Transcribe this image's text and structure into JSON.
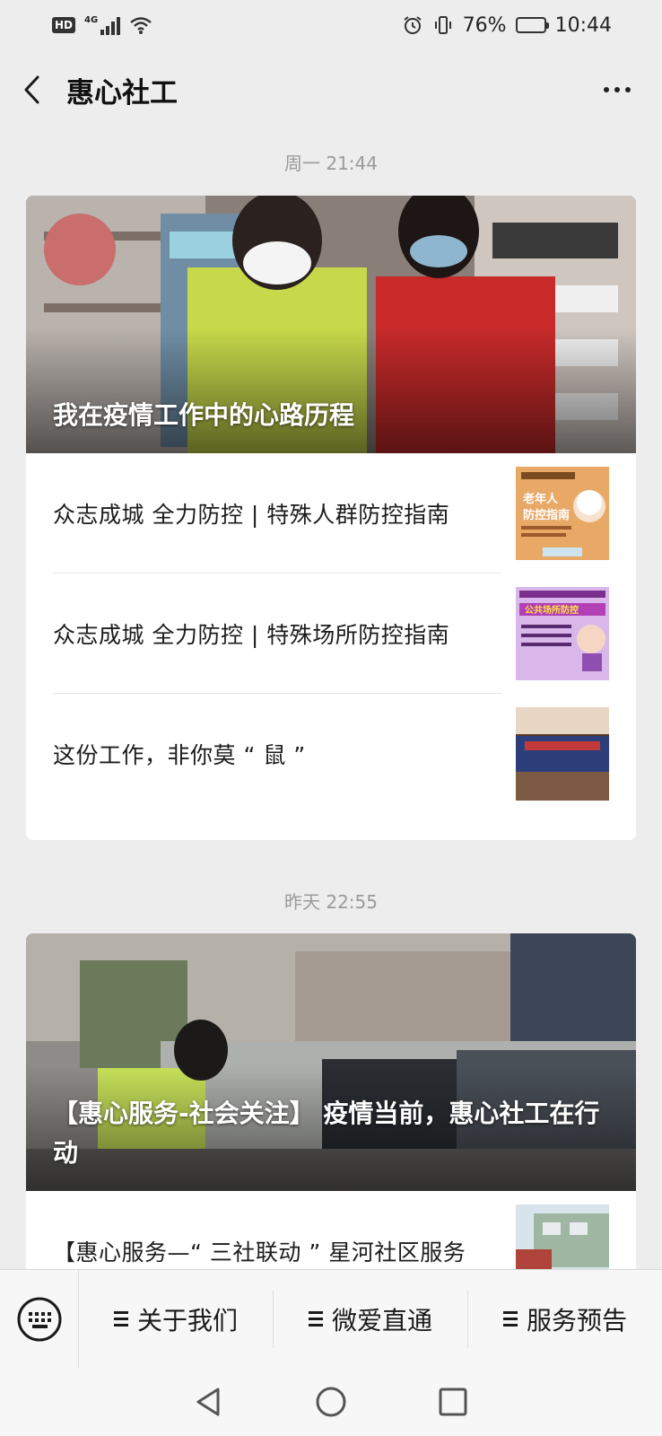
{
  "status_bar": {
    "hd": "HD",
    "network": "4G",
    "battery_percent_text": "76%",
    "battery_level": 0.76,
    "time": "10:44"
  },
  "nav": {
    "title": "惠心社工"
  },
  "groups": [
    {
      "timestamp": "周一 21:44",
      "cover_title": "我在疫情工作中的心路历程",
      "articles": [
        {
          "title": "众志成城  全力防控  | 特殊人群防控指南",
          "thumb_icon": "elderly-guide-thumbnail"
        },
        {
          "title": "众志成城  全力防控  | 特殊场所防控指南",
          "thumb_icon": "public-place-guide-thumbnail"
        },
        {
          "title": "这份工作，非你莫 “ 鼠 ”",
          "thumb_icon": "group-photo-thumbnail"
        }
      ]
    },
    {
      "timestamp": "昨天 22:55",
      "cover_title": "【惠心服务-社会关注】 疫情当前，惠心社工在行动",
      "articles": [
        {
          "title": "【惠心服务—“ 三社联动 ” 星河社区服务",
          "thumb_icon": "community-photo-thumbnail"
        }
      ]
    }
  ],
  "menu": {
    "items": [
      "关于我们",
      "微爱直通",
      "服务预告"
    ]
  },
  "colors": {
    "background": "#ededed",
    "card": "#ffffff",
    "timestamp": "#9a9a9a"
  }
}
